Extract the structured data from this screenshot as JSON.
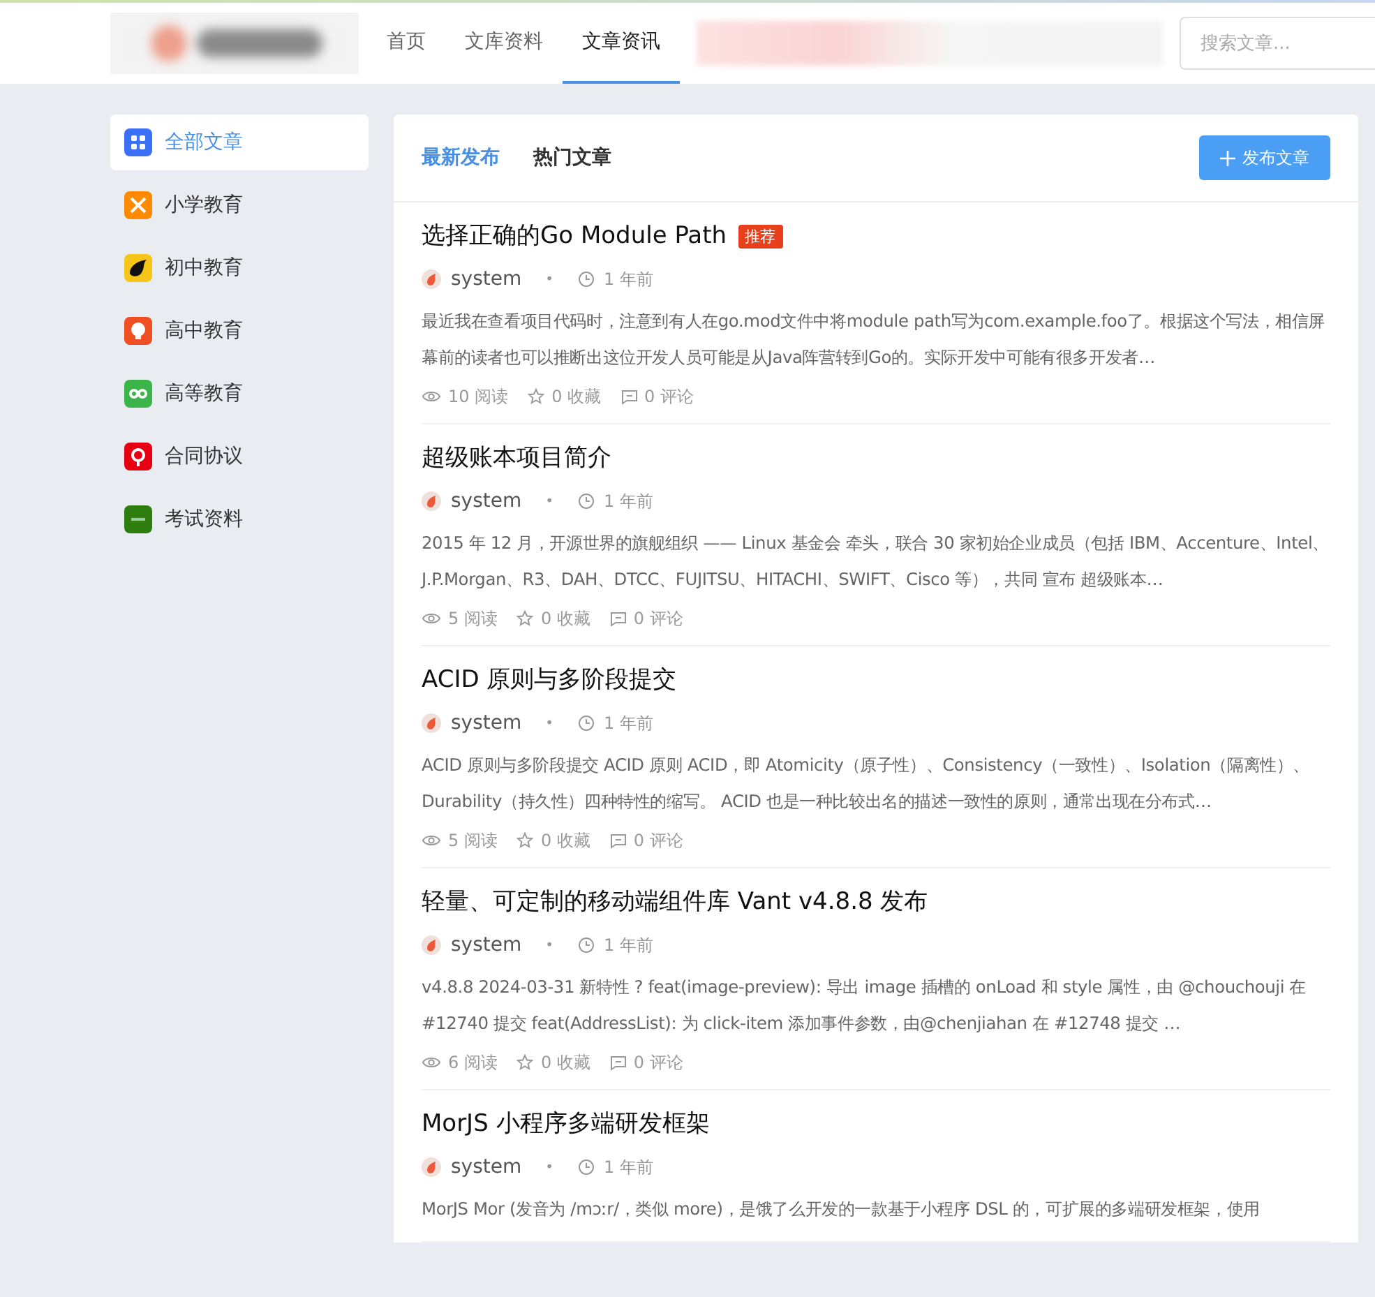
{
  "header": {
    "nav": [
      {
        "label": "首页",
        "selected": false
      },
      {
        "label": "文库资料",
        "selected": false
      },
      {
        "label": "文章资讯",
        "selected": true
      }
    ],
    "search": {
      "placeholder": "搜索文章..."
    }
  },
  "sidebar": {
    "items": [
      {
        "label": "全部文章",
        "selected": true,
        "color": "#3a6ff7"
      },
      {
        "label": "小学教育",
        "selected": false,
        "color": "#ff8a00"
      },
      {
        "label": "初中教育",
        "selected": false,
        "color": "#f5c518"
      },
      {
        "label": "高中教育",
        "selected": false,
        "color": "#f04e23"
      },
      {
        "label": "高等教育",
        "selected": false,
        "color": "#3bb54a"
      },
      {
        "label": "合同协议",
        "selected": false,
        "color": "#e60012"
      },
      {
        "label": "考试资料",
        "selected": false,
        "color": "#2e7d0f"
      }
    ]
  },
  "tabs": [
    {
      "label": "最新发布",
      "selected": true
    },
    {
      "label": "热门文章",
      "selected": false
    }
  ],
  "publish_button": "发布文章",
  "articles": [
    {
      "title": "选择正确的Go Module Path",
      "badge": "推荐",
      "author": "system",
      "separator": "•",
      "time": "1 年前",
      "excerpt": "最近我在查看项目代码时，注意到有人在go.mod文件中将module path写为com.example.foo了。根据这个写法，相信屏幕前的读者也可以推断出这位开发人员可能是从Java阵营转到Go的。实际开发中可能有很多开发者…",
      "views": "10 阅读",
      "favorites": "0 收藏",
      "comments": "0 评论"
    },
    {
      "title": "超级账本项目简介",
      "author": "system",
      "separator": "•",
      "time": "1 年前",
      "excerpt": "2015 年 12 月，开源世界的旗舰组织 —— Linux 基金会 牵头，联合 30 家初始企业成员（包括 IBM、Accenture、Intel、J.P.Morgan、R3、DAH、DTCC、FUJITSU、HITACHI、SWIFT、Cisco 等），共同 宣布 超级账本…",
      "views": "5 阅读",
      "favorites": "0 收藏",
      "comments": "0 评论"
    },
    {
      "title": "ACID 原则与多阶段提交",
      "author": "system",
      "separator": "•",
      "time": "1 年前",
      "excerpt": "ACID 原则与多阶段提交 ACID 原则 ACID，即 Atomicity（原子性）、Consistency（一致性）、Isolation（隔离性）、Durability（持久性）四种特性的缩写。 ACID 也是一种比较出名的描述一致性的原则，通常出现在分布式…",
      "views": "5 阅读",
      "favorites": "0 收藏",
      "comments": "0 评论"
    },
    {
      "title": "轻量、可定制的移动端组件库 Vant v4.8.8 发布",
      "author": "system",
      "separator": "•",
      "time": "1 年前",
      "excerpt": "v4.8.8 2024-03-31 新特性 ? feat(image-preview): 导出 image 插槽的 onLoad 和 style 属性，由 @chouchouji 在 #12740 提交 feat(AddressList): 为 click-item 添加事件参数，由@chenjiahan 在 #12748 提交 …",
      "views": "6 阅读",
      "favorites": "0 收藏",
      "comments": "0 评论"
    },
    {
      "title": "MorJS 小程序多端研发框架",
      "author": "system",
      "separator": "•",
      "time": "1 年前",
      "excerpt": "MorJS Mor (发音为 /mɔːr/，类似 more)，是饿了么开发的一款基于小程序 DSL 的，可扩展的多端研发框架，使用"
    }
  ]
}
